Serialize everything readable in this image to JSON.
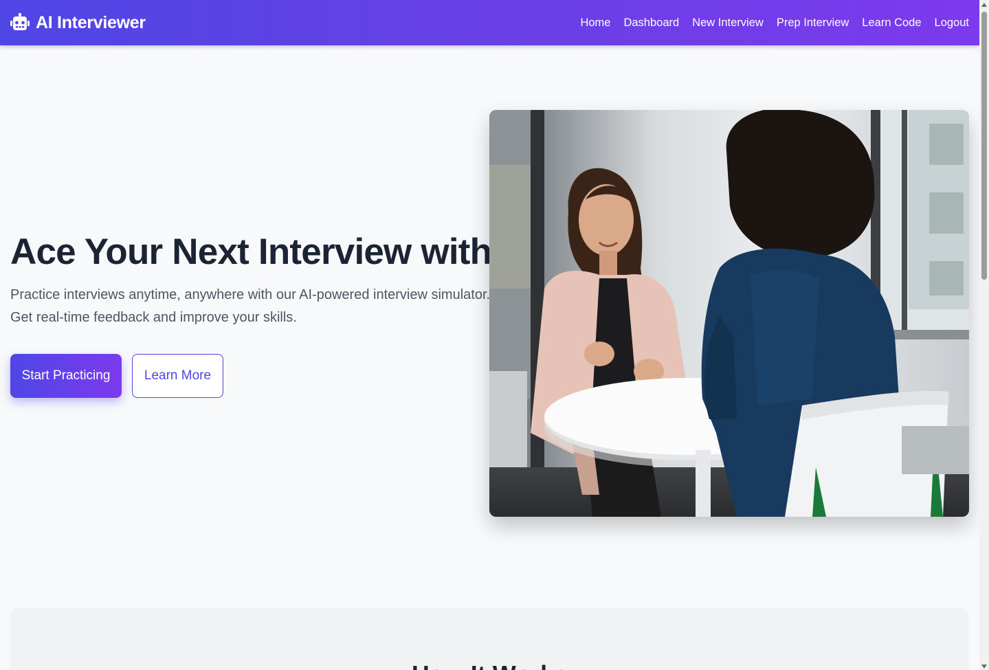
{
  "nav": {
    "brand": "AI Interviewer",
    "brand_icon": "robot-icon",
    "links": [
      "Home",
      "Dashboard",
      "New Interview",
      "Prep Interview",
      "Learn Code",
      "Logout"
    ]
  },
  "hero": {
    "title": "Ace Your Next Interview with AI",
    "subtitle": "Practice interviews anytime, anywhere with our AI-powered interview simulator. Get real-time feedback and improve your skills.",
    "primary_button": "Start Practicing",
    "secondary_button": "Learn More"
  },
  "how_it_works": {
    "title": "How It Works"
  },
  "colors": {
    "accent": "#4f46e5",
    "accent_end": "#7c3aed",
    "heading": "#1c2434",
    "body_text": "#4b5563"
  }
}
